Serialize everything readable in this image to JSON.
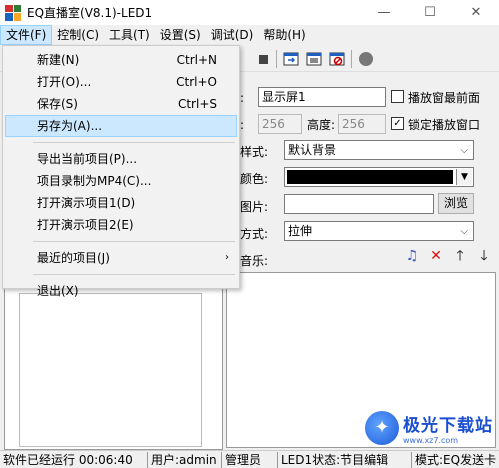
{
  "window": {
    "title": "EQ直播室(V8.1)-LED1",
    "minimize": "—",
    "maximize": "☐",
    "close": "✕"
  },
  "menubar": [
    {
      "label": "文件(F)"
    },
    {
      "label": "控制(C)"
    },
    {
      "label": "工具(T)"
    },
    {
      "label": "设置(S)"
    },
    {
      "label": "调试(D)"
    },
    {
      "label": "帮助(H)"
    }
  ],
  "file_menu": {
    "new": {
      "label": "新建(N)",
      "shortcut": "Ctrl+N"
    },
    "open": {
      "label": "打开(O)...",
      "shortcut": "Ctrl+O"
    },
    "save": {
      "label": "保存(S)",
      "shortcut": "Ctrl+S"
    },
    "save_as": {
      "label": "另存为(A)..."
    },
    "export_current": {
      "label": "导出当前项目(P)..."
    },
    "record_mp4": {
      "label": "项目录制为MP4(C)..."
    },
    "open_demo1": {
      "label": "打开演示项目1(D)"
    },
    "open_demo2": {
      "label": "打开演示项目2(E)"
    },
    "recent": {
      "label": "最近的项目(J)",
      "arrow": "›"
    },
    "exit": {
      "label": "退出(X)"
    }
  },
  "props": {
    "name_label": "称:",
    "name_value": "显示屏1",
    "always_front": "播放窗最前面",
    "width_label": "度:",
    "width_value": "256",
    "height_label": "高度:",
    "height_value": "256",
    "lock_window": "锁定播放窗口",
    "lock_checked": "✓",
    "bg_style_label": "景样式:",
    "bg_style_value": "默认背景",
    "bg_color_label": "景颜色:",
    "bg_color": "#000000",
    "bg_image_label": "景图片:",
    "browse": "浏览",
    "image_mode_label": "片方式:",
    "image_mode_value": "拉伸",
    "bg_music_label": "景音乐:"
  },
  "statusbar": {
    "runtime": "软件已经运行 00:06:40",
    "user": "用户:admin",
    "role": "管理员",
    "led_status": "LED1状态:节目编辑",
    "mode": "模式:EQ发送卡"
  },
  "watermark": {
    "main": "极光下载站",
    "sub": "www.xz7.com"
  }
}
